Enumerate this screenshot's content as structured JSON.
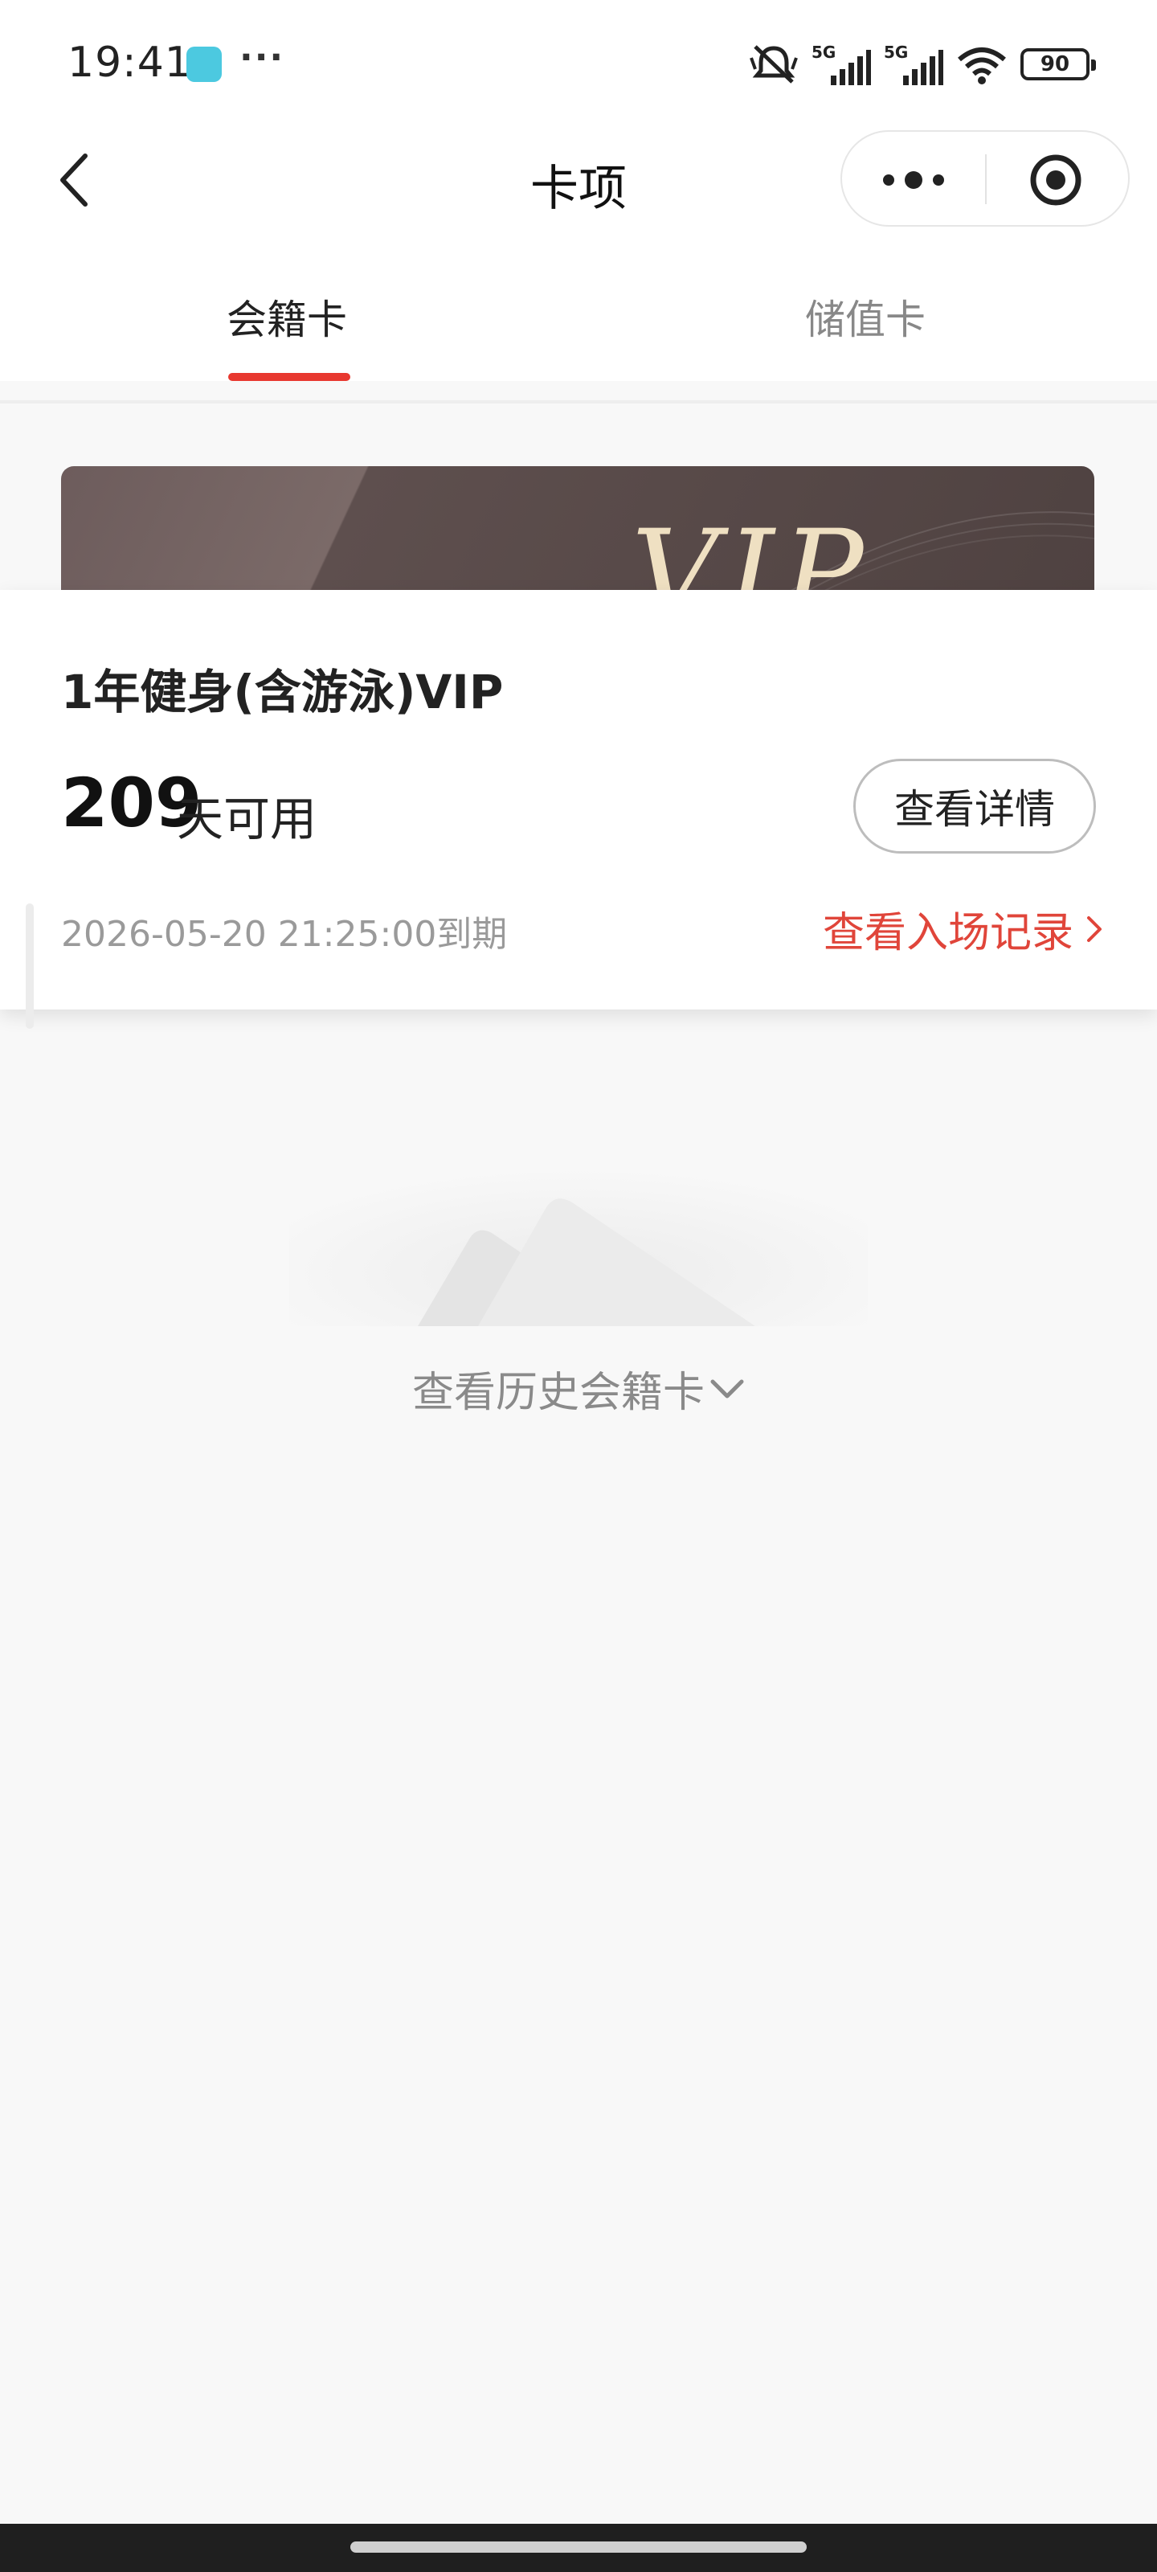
{
  "status_bar": {
    "time": "19:41",
    "more": "···",
    "network_1": "5G",
    "network_2": "5G",
    "battery": "90"
  },
  "nav": {
    "title": "卡项"
  },
  "tabs": [
    {
      "label": "会籍卡",
      "active": true
    },
    {
      "label": "储值卡",
      "active": false
    }
  ],
  "card": {
    "badge": "VIP",
    "name": "1年健身(含游泳)VIP",
    "days_left": "209",
    "days_unit": "天可用",
    "detail_button": "查看详情",
    "expiry": "2026-05-20 21:25:00到期",
    "entry_record_link": "查看入场记录"
  },
  "history": {
    "label": "查看历史会籍卡"
  },
  "colors": {
    "accent_red": "#e8382f",
    "link_red": "#e0453a",
    "card_dark": "#5e4f4e",
    "vip_gold": "#efe0c2"
  }
}
